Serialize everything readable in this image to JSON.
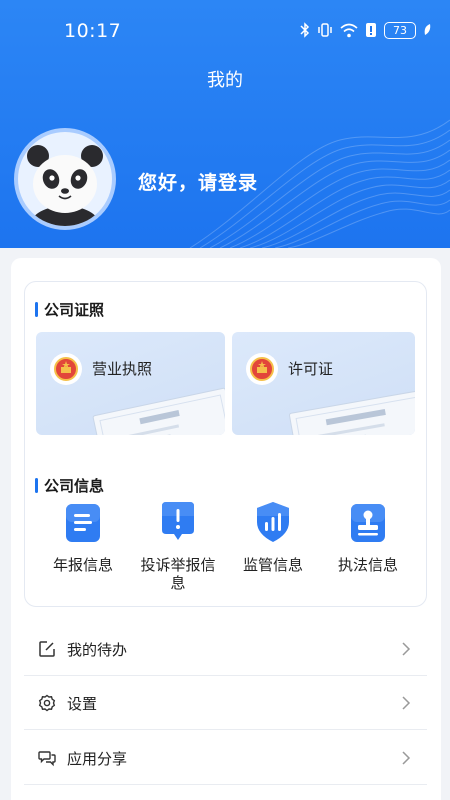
{
  "status_bar": {
    "time": "10:17",
    "battery": "73"
  },
  "header": {
    "title": "我的",
    "greeting": "您好，请登录"
  },
  "company_license": {
    "title": "公司证照",
    "cards": [
      {
        "label": "营业执照"
      },
      {
        "label": "许可证"
      }
    ]
  },
  "company_info": {
    "title": "公司信息",
    "items": [
      {
        "label": "年报信息",
        "icon": "report-icon"
      },
      {
        "label": "投诉举报信\n息",
        "icon": "complaint-icon"
      },
      {
        "label": "监管信息",
        "icon": "supervision-icon"
      },
      {
        "label": "执法信息",
        "icon": "enforcement-icon"
      }
    ]
  },
  "menu": [
    {
      "label": "我的待办",
      "icon": "edit-icon"
    },
    {
      "label": "设置",
      "icon": "gear-icon"
    },
    {
      "label": "应用分享",
      "icon": "share-icon"
    }
  ],
  "colors": {
    "primary": "#1d74ef",
    "background": "#f1f3f7"
  }
}
